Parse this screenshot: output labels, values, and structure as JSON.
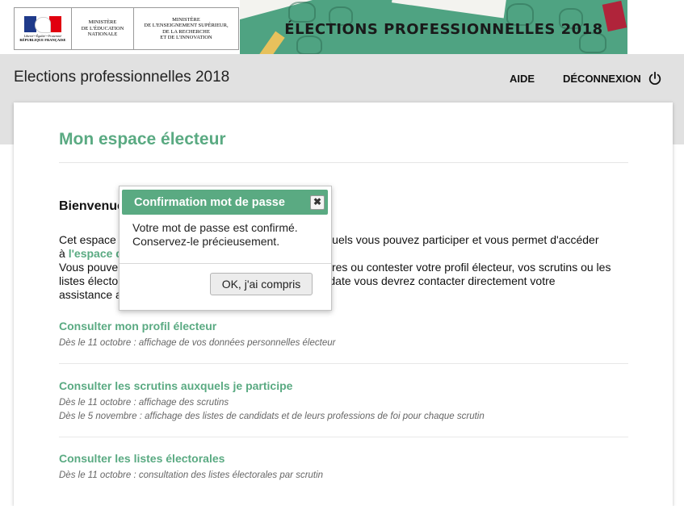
{
  "header": {
    "logo_republique": {
      "motto": "Liberté • Égalité • Fraternité",
      "name": "RÉPUBLIQUE FRANÇAISE"
    },
    "logo_men": "MINISTÈRE\nDE L'ÉDUCATION\nNATIONALE",
    "logo_mesr": "MINISTÈRE\nDE L'ENSEIGNEMENT SUPÉRIEUR,\nDE LA RECHERCHE\nET DE L'INNOVATION",
    "banner_title": "ÉLECTIONS PROFESSIONNELLES 2018"
  },
  "navbar": {
    "title": "Elections professionnelles 2018",
    "help_label": "AIDE",
    "logout_label": "DÉCONNEXION",
    "logout_icon": "power-icon"
  },
  "main": {
    "page_title": "Mon espace électeur",
    "welcome": "Bienvenue",
    "intro": {
      "line1_start": "Cet espace",
      "line1_end": "auxquels vous pouvez participer et vous permet d'accéder",
      "line2_start": "à",
      "line2_link": "l'espace d",
      "line3_start": "Vous pouve",
      "line3_end": "taires ou contester votre profil électeur, vos scrutins ou les",
      "line4_start": "listes électo",
      "line4_end": "ette date vous devrez contacter directement votre",
      "line5_start": "assistance a"
    },
    "sections": [
      {
        "title": "Consulter mon profil électeur",
        "notes": [
          "Dès le 11 octobre : affichage de vos données personnelles électeur"
        ]
      },
      {
        "title": "Consulter les scrutins auxquels je participe",
        "notes": [
          "Dès le 11 octobre : affichage des scrutins",
          "Dès le 5 novembre : affichage des listes de candidats et de leurs professions de foi pour chaque scrutin"
        ]
      },
      {
        "title": "Consulter les listes électorales",
        "notes": [
          "Dès le 11 octobre : consultation des listes électorales par scrutin"
        ]
      }
    ]
  },
  "modal": {
    "title": "Confirmation mot de passe",
    "close_icon": "close-icon",
    "close_glyph": "✖",
    "message_line1": "Votre mot de passe est confirmé.",
    "message_line2": "Conservez-le précieusement.",
    "ok_label": "OK, j'ai compris"
  },
  "colors": {
    "accent_green": "#5aaa82",
    "banner_green": "#4fa382",
    "grey_band": "#e1e1e1"
  }
}
